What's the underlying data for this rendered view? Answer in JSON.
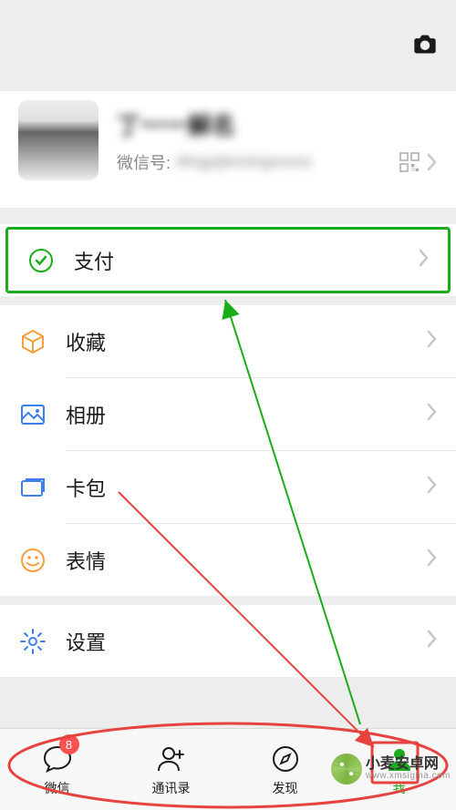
{
  "profile": {
    "name": "丁一一解名",
    "id_label": "微信号:",
    "id_value": "dingyijiemingxxxxx"
  },
  "menu": {
    "pay": {
      "label": "支付",
      "icon_color": "#1aad19"
    },
    "favorites": {
      "label": "收藏",
      "icon_color": "#fa9d3b"
    },
    "album": {
      "label": "相册",
      "icon_color": "#3d7ef0"
    },
    "cards": {
      "label": "卡包",
      "icon_color": "#3d7ef0"
    },
    "stickers": {
      "label": "表情",
      "icon_color": "#fa9d3b"
    },
    "settings": {
      "label": "设置",
      "icon_color": "#3d7ef0"
    }
  },
  "tabs": {
    "chats": {
      "label": "微信",
      "badge": "8"
    },
    "contacts": {
      "label": "通讯录"
    },
    "discover": {
      "label": "发现"
    },
    "me": {
      "label": "我"
    }
  },
  "watermark": {
    "brand": "小麦安卓网",
    "domain": "www.xmsigma.com"
  }
}
